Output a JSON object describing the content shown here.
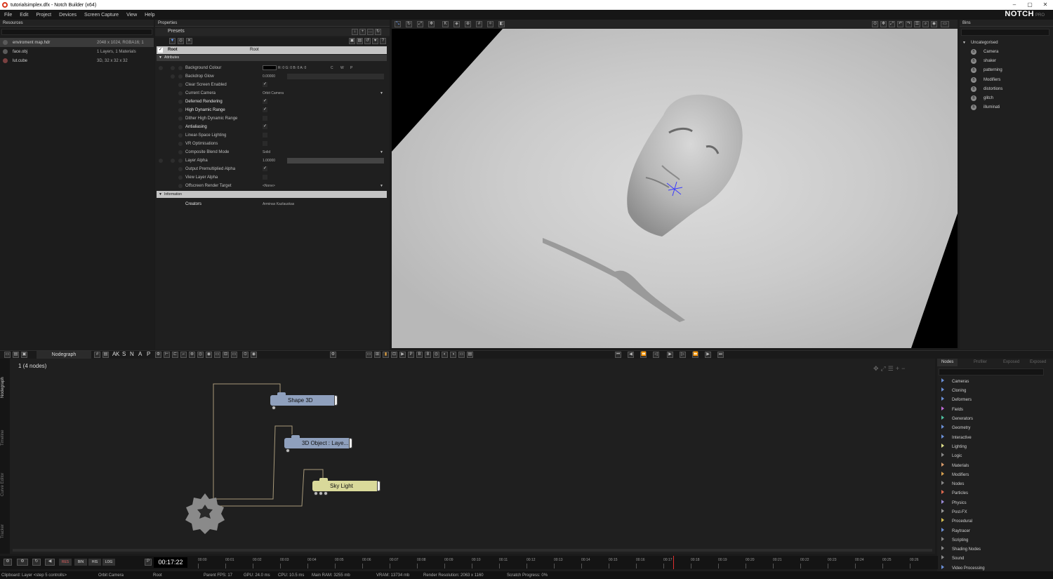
{
  "window": {
    "title": "tutorialsimplex.dfx - Notch Builder (x64)",
    "controls": [
      "–",
      "▢",
      "✕"
    ]
  },
  "menu": [
    "File",
    "Edit",
    "Project",
    "Devices",
    "Screen Capture",
    "View",
    "Help"
  ],
  "logo": {
    "brand": "NOTCH",
    "edition": "PRO"
  },
  "resources": {
    "title": "Resources",
    "items": [
      {
        "name": "enviroment map.hdr",
        "info": "2048 x 1024, RGBA16; 1"
      },
      {
        "name": "face.obj",
        "info": "1 Layers, 1 Materials"
      },
      {
        "name": "lut.cube",
        "info": "3D, 32 x 32 x 32"
      }
    ]
  },
  "properties": {
    "title": "Properties",
    "presets_label": "Presets",
    "root_label": "Root",
    "root_value": "Root",
    "attributes_label": "Attributes",
    "rows": [
      {
        "name": "Background Colour",
        "value": "R: 0 G: 0 B: 0 A: 0",
        "bright": false
      },
      {
        "name": "Backdrop Glow",
        "value": "0.00000",
        "bright": false
      },
      {
        "name": "Clear Screen Enabled",
        "value": "✓",
        "bright": false
      },
      {
        "name": "Current Camera",
        "value": "Orbit Camera",
        "bright": false
      },
      {
        "name": "Deferred Rendering",
        "value": "✓",
        "bright": true
      },
      {
        "name": "High Dynamic Range",
        "value": "✓",
        "bright": true
      },
      {
        "name": "Dither High Dynamic Range",
        "value": "",
        "bright": false
      },
      {
        "name": "Antialiasing",
        "value": "✓",
        "bright": true
      },
      {
        "name": "Linear-Space Lighting",
        "value": "",
        "bright": false
      },
      {
        "name": "VR Optimisations",
        "value": "",
        "bright": false
      },
      {
        "name": "Composite Blend Mode",
        "value": "Solid",
        "bright": false
      },
      {
        "name": "Layer Alpha",
        "value": "1.00000",
        "bright": false
      },
      {
        "name": "Output Premultiplied Alpha",
        "value": "✓",
        "bright": false
      },
      {
        "name": "View Layer Alpha",
        "value": "",
        "bright": false
      },
      {
        "name": "Offscreen Render Target",
        "value": "<None>",
        "bright": false
      }
    ],
    "color_channels": [
      "C",
      "W",
      "P"
    ],
    "information_label": "Information",
    "creators_label": "Creators",
    "creators_value": "Arminas Kazlauskas"
  },
  "bins": {
    "title": "Bins",
    "root": "Uncategorised",
    "items": [
      "Camera",
      "shaker",
      "patterning",
      "Modifiers",
      "distortions",
      "glitch",
      "illuminati"
    ]
  },
  "nodegraph": {
    "tab": "Nodegraph",
    "toolbar_chars": [
      "A",
      "K",
      "S",
      "N",
      "A",
      "P"
    ],
    "count": "1  (4  nodes)",
    "nodes": [
      {
        "label": "Shape  3D",
        "color": "#8fa0bd"
      },
      {
        "label": "3D  Object  :  Laye...",
        "color": "#8fa0bd"
      },
      {
        "label": "Sky  Light",
        "color": "#d9d99a"
      }
    ],
    "side_tabs": [
      "Nodegraph",
      "Timeline",
      "Curve Editor",
      "Tracker"
    ]
  },
  "nodes_panel": {
    "tabs": [
      "Nodes",
      "Profiler",
      "Exposed",
      "Exposed"
    ],
    "categories": [
      {
        "name": "Cameras",
        "color": "#6a8fd6"
      },
      {
        "name": "Cloning",
        "color": "#6a8fd6"
      },
      {
        "name": "Deformers",
        "color": "#6a8fd6"
      },
      {
        "name": "Fields",
        "color": "#c06ad6"
      },
      {
        "name": "Generators",
        "color": "#4fc0a0"
      },
      {
        "name": "Geometry",
        "color": "#6a8fd6"
      },
      {
        "name": "Interactive",
        "color": "#6a8fd6"
      },
      {
        "name": "Lighting",
        "color": "#e0e08a"
      },
      {
        "name": "Logic",
        "color": "#8a8a8a"
      },
      {
        "name": "Materials",
        "color": "#d69a6a"
      },
      {
        "name": "Modifiers",
        "color": "#d6a04f"
      },
      {
        "name": "Nodes",
        "color": "#8a8a8a"
      },
      {
        "name": "Particles",
        "color": "#e06a4f"
      },
      {
        "name": "Physics",
        "color": "#9a8ad6"
      },
      {
        "name": "Post-FX",
        "color": "#9a9a9a"
      },
      {
        "name": "Procedural",
        "color": "#d6c04f"
      },
      {
        "name": "Raytracer",
        "color": "#6a8fd6"
      },
      {
        "name": "Scripting",
        "color": "#8a8a8a"
      },
      {
        "name": "Shading Nodes",
        "color": "#8a8a8a"
      },
      {
        "name": "Sound",
        "color": "#8a8a8a"
      },
      {
        "name": "Video Processing",
        "color": "#6a8fd6"
      }
    ]
  },
  "timeline": {
    "timecode": "00:17:22",
    "buttons": [
      "RES",
      "BIN",
      "HIS",
      "LOG"
    ],
    "ticks": [
      "00:00",
      "00:01",
      "00:02",
      "00:03",
      "00:04",
      "00:05",
      "00:06",
      "00:07",
      "00:08",
      "00:09",
      "00:10",
      "00:11",
      "00:12",
      "00:13",
      "00:14",
      "00:15",
      "00:16",
      "00:17",
      "00:18",
      "00:19",
      "00:20",
      "00:21",
      "00:22",
      "00:23",
      "00:24",
      "00:25",
      "00:26"
    ]
  },
  "status": [
    "Clipboard: Layer <step 5 controlls>",
    "Orbit Camera",
    "Root",
    "Parent FPS: 17",
    "GPU: 24.0 ms",
    "CPU: 10.5 ms",
    "Main RAM: 3255 mb",
    "VRAM: 13734 mb",
    "Render Resolution: 2063 x 1160",
    "Scratch Progress: 0%"
  ]
}
